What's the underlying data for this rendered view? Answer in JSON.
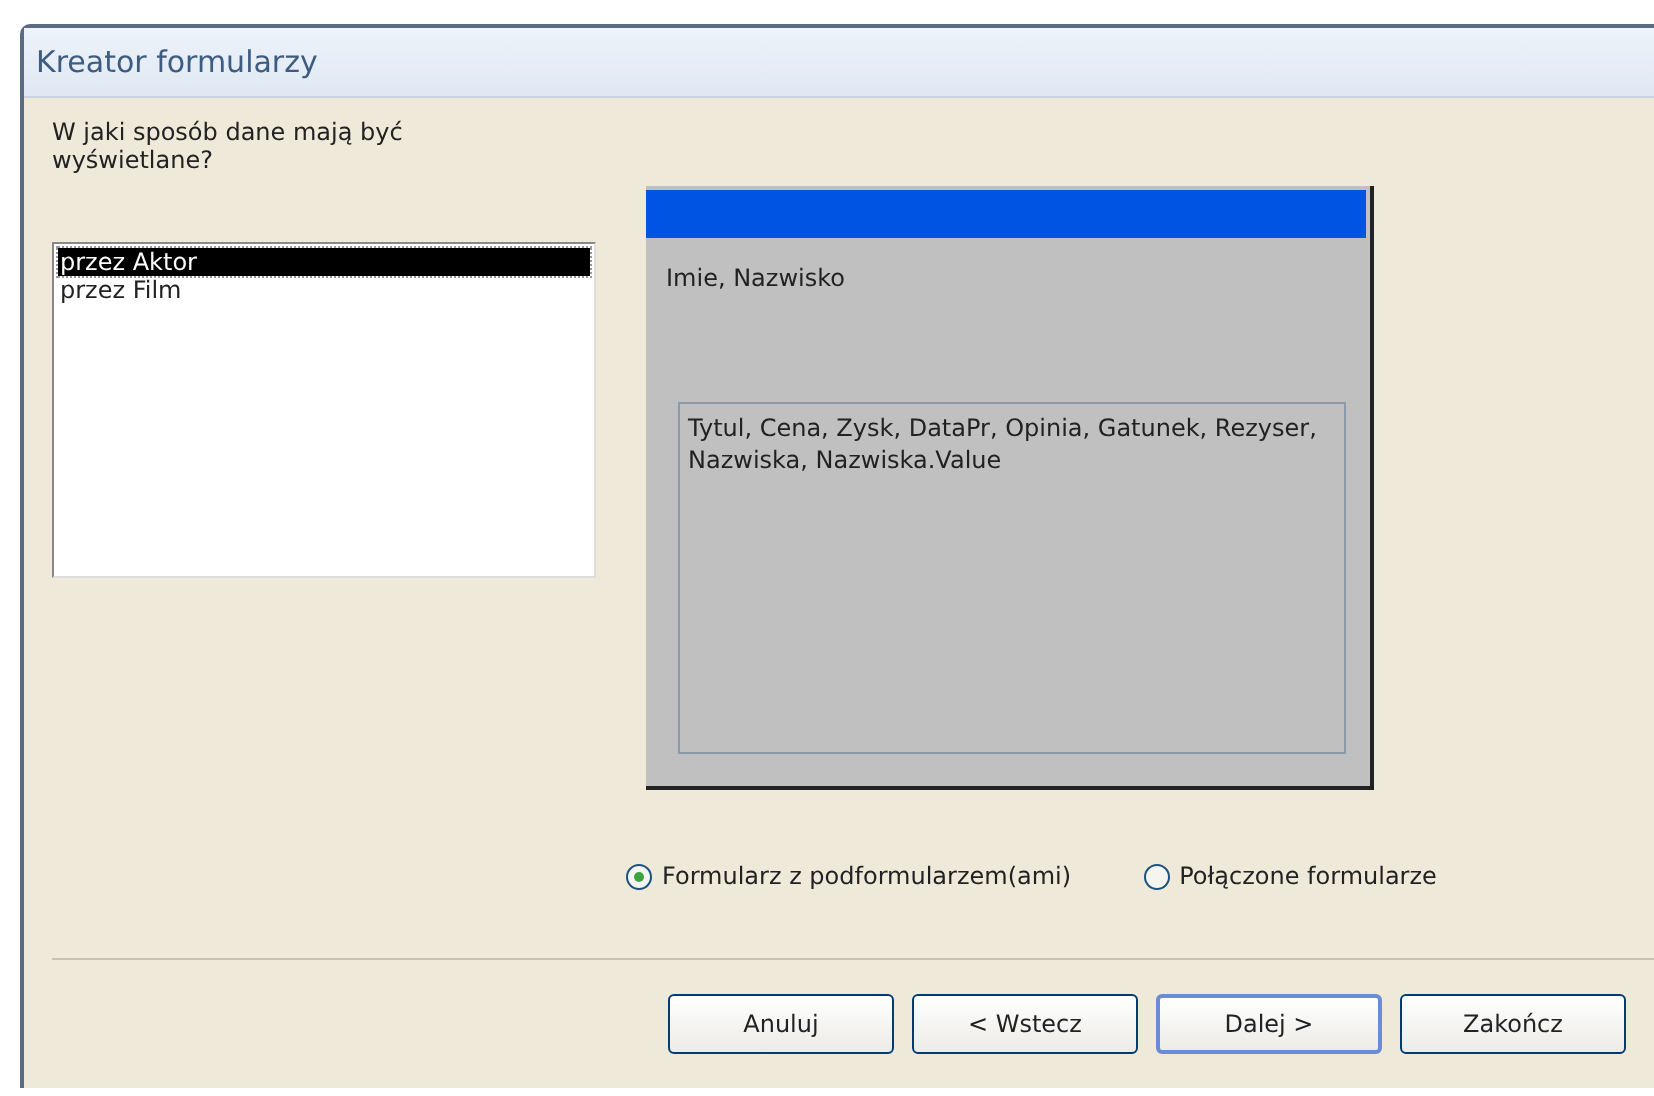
{
  "window": {
    "title": "Kreator formularzy"
  },
  "question": "W jaki sposób dane mają być wyświetlane?",
  "views": [
    {
      "label": "przez Aktor",
      "selected": true
    },
    {
      "label": "przez Film",
      "selected": false
    }
  ],
  "preview": {
    "main_fields": "Imie, Nazwisko",
    "sub_fields": "Tytul, Cena, Zysk, DataPr, Opinia, Gatunek, Rezyser, Nazwiska, Nazwiska.Value"
  },
  "layout_options": [
    {
      "label": "Formularz z podformularzem(ami)",
      "selected": true
    },
    {
      "label": "Połączone formularze",
      "selected": false
    }
  ],
  "buttons": [
    {
      "label": "Anuluj",
      "default": false
    },
    {
      "label": "< Wstecz",
      "default": false
    },
    {
      "label": "Dalej >",
      "default": true
    },
    {
      "label": "Zakończ",
      "default": false
    }
  ]
}
